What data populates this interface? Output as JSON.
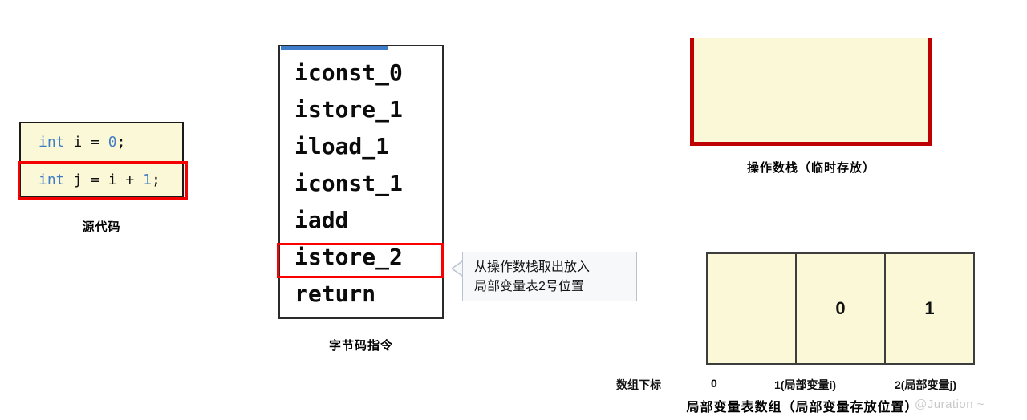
{
  "source_code": {
    "caption": "源代码",
    "lines": [
      {
        "kw": "int",
        "sp1": " ",
        "name": "i",
        "op": " = ",
        "val": "0",
        "end": ";"
      },
      {
        "kw": "int",
        "sp1": " ",
        "name": "j",
        "op": " = ",
        "val": "i + 1",
        "end": ";"
      }
    ],
    "line1_kw": "int",
    "line1_name": " i ",
    "line1_eq": "= ",
    "line1_val": "0",
    "line1_semi": ";",
    "line2_kw": "int",
    "line2_name": " j ",
    "line2_eq": "= ",
    "line2_var": "i ",
    "line2_plus": "+ ",
    "line2_val": "1",
    "line2_semi": ";",
    "highlighted_line_index": 1
  },
  "bytecode": {
    "caption": "字节码指令",
    "instructions": [
      "iconst_0",
      "istore_1",
      "iload_1",
      "iconst_1",
      "iadd",
      "istore_2",
      "return"
    ],
    "highlighted_index": 5,
    "progress_bar_color": "#3d7cc9",
    "highlight_color": "#fa0000"
  },
  "callout": {
    "line1": "从操作数栈取出放入",
    "line2": "局部变量表2号位置",
    "border_color": "#b9c3cf",
    "background_color": "#f7f8fa"
  },
  "operand_stack": {
    "caption": "操作数栈（临时存放）",
    "items": [],
    "border_color": "#c00000",
    "fill_color": "#fbf8d8"
  },
  "local_variable_table": {
    "caption": "局部变量表数组（局部变量存放位置）",
    "index_row_title": "数组下标",
    "cells": [
      {
        "value": "",
        "index_label": "0"
      },
      {
        "value": "0",
        "index_label": "1(局部变量i)"
      },
      {
        "value": "1",
        "index_label": "2(局部变量j)"
      }
    ],
    "border_color": "#3d3d3d",
    "fill_color": "#fbf8d8"
  },
  "watermark": {
    "text": "@Juration ~"
  }
}
